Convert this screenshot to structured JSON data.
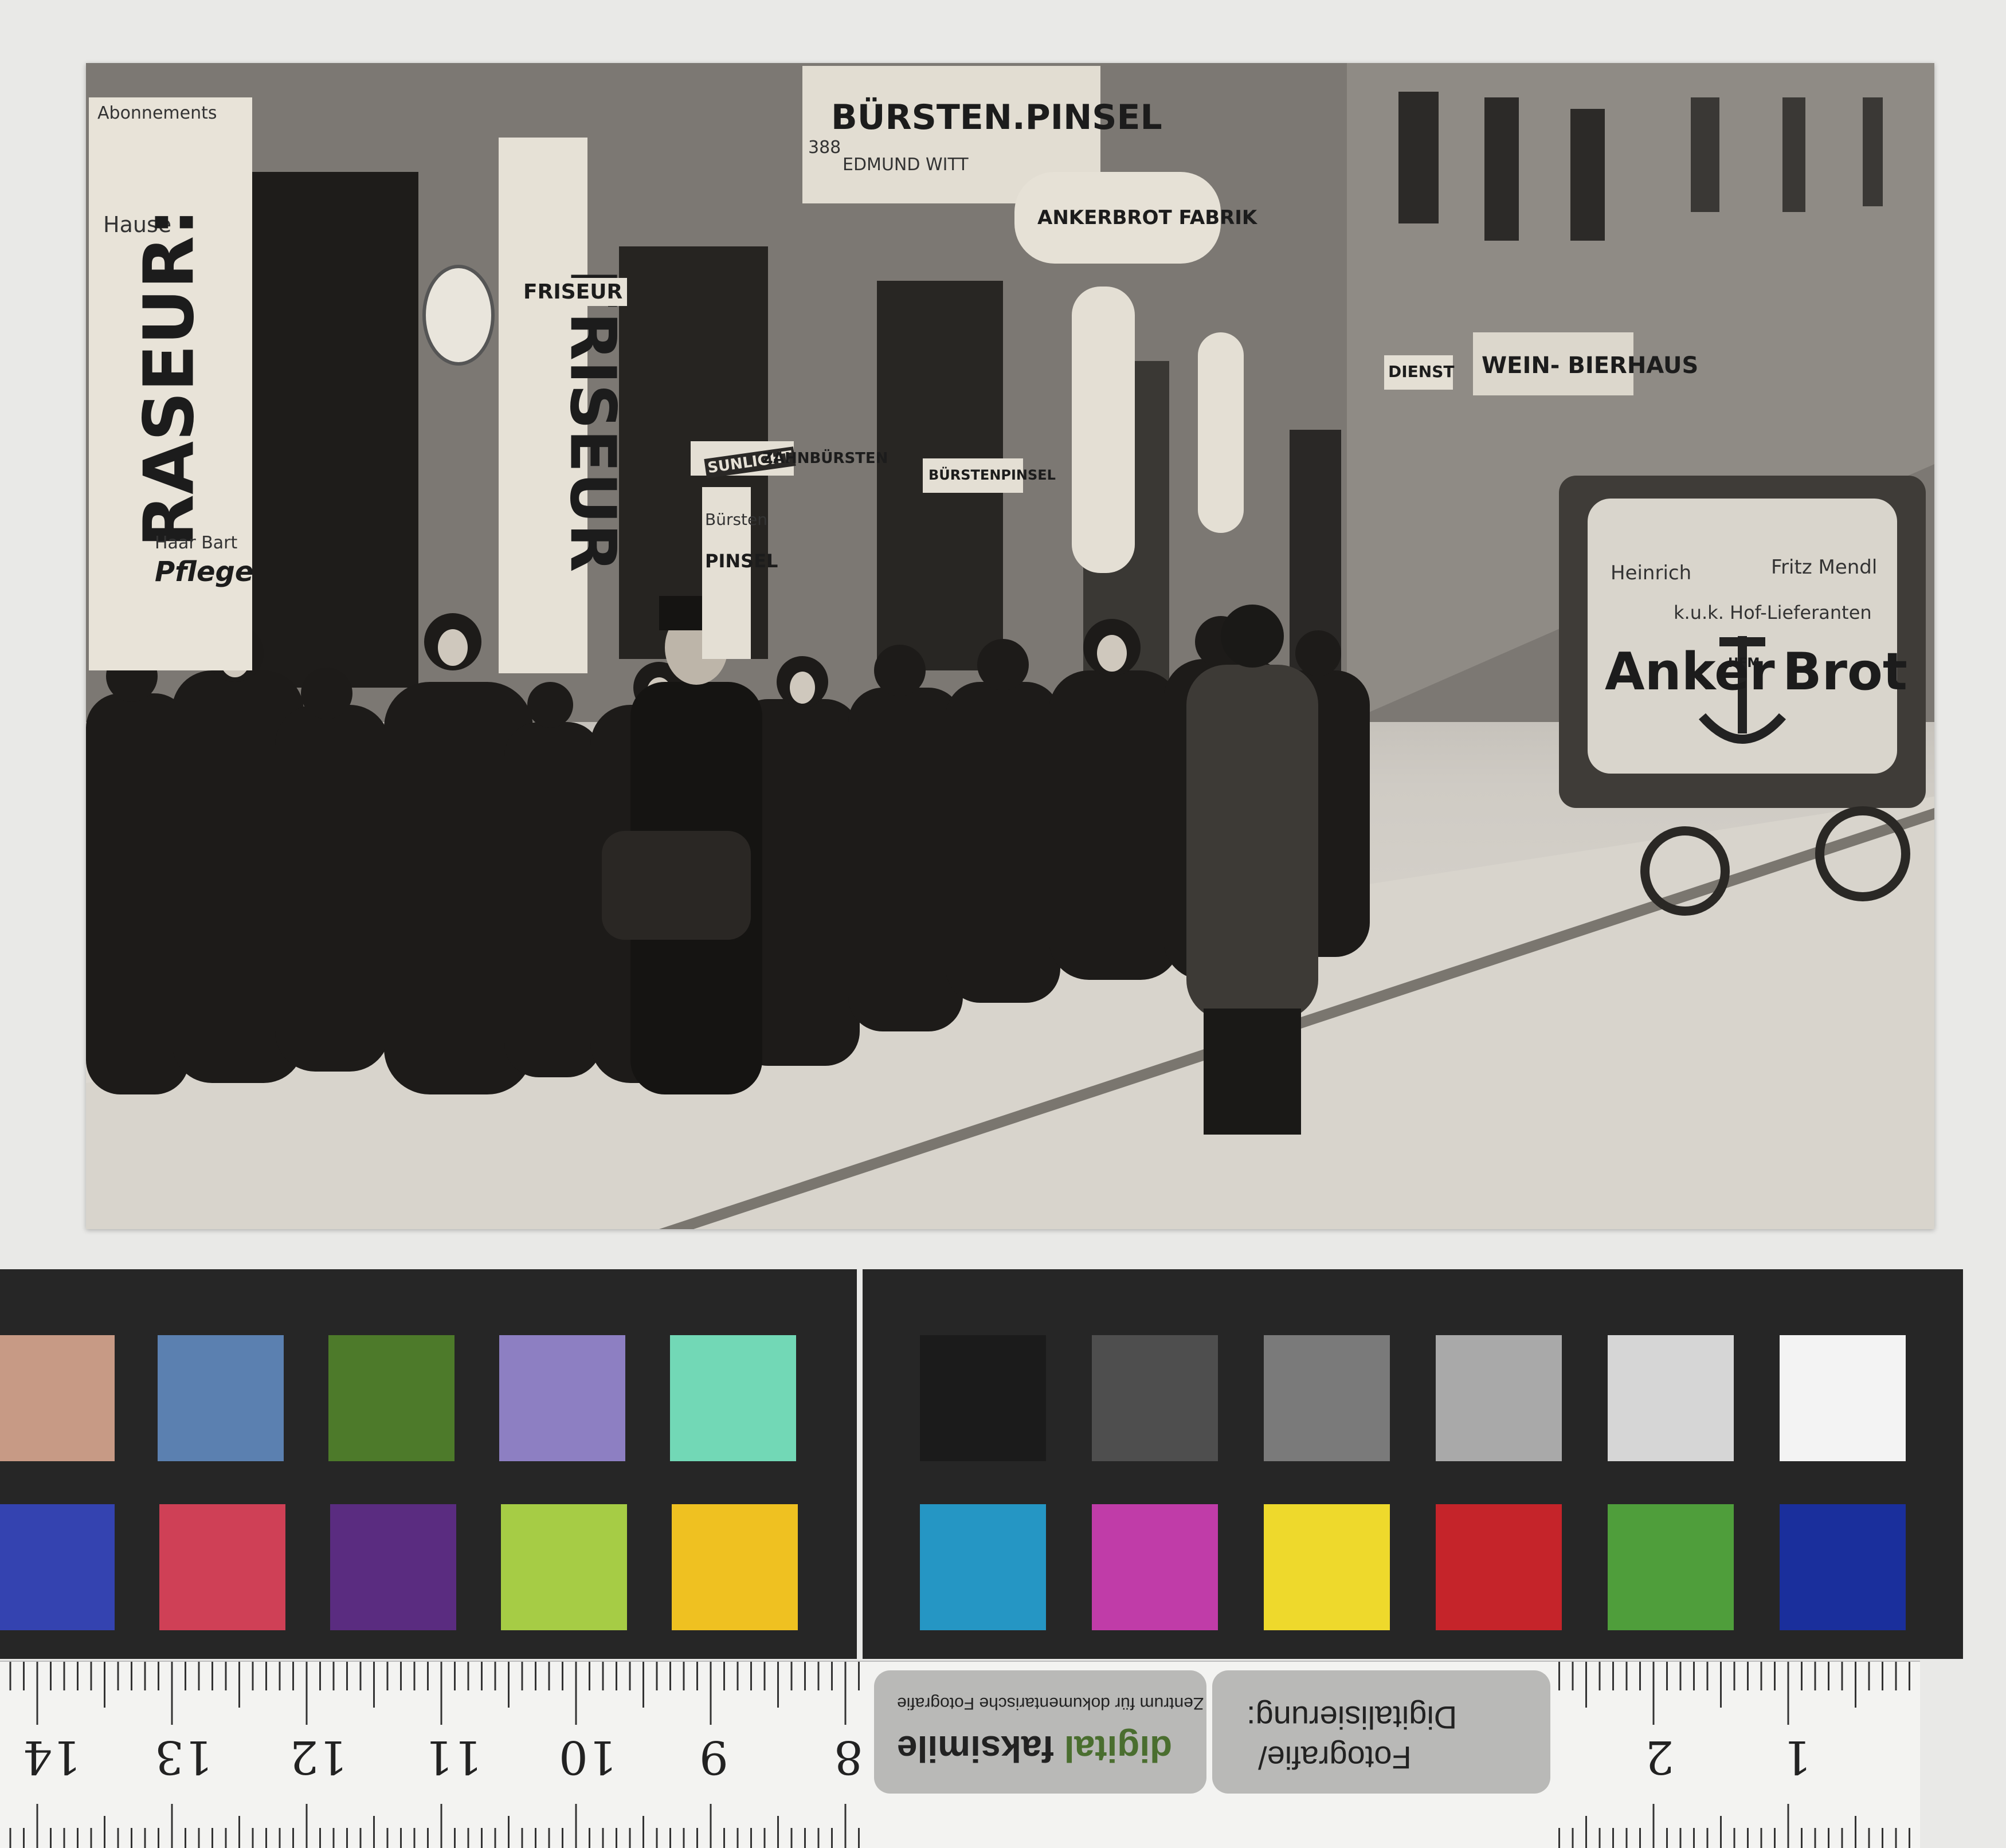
{
  "photo": {
    "signs": {
      "raseur": "RASEUR:",
      "abonnements": "Abonnements",
      "hause": "Hause",
      "haar_bart": "Haar Bart",
      "pflege": "Pflege",
      "friseur_board": "FRISEUR",
      "friseur_small": "FRISEUR",
      "buersten_pinsel": "BÜRSTEN.PINSEL",
      "edmund": "EDMUND WITT",
      "number": "388",
      "ankerbrot_fabrik": "ANKERBROT FABRIK",
      "sunlight": "SUNLIGHT",
      "zahnbuersten": "ZAHNBÜRSTEN",
      "buersten": "Bürsten",
      "pinsel": "PINSEL",
      "buerstenpinsel_small": "BÜRSTENPINSEL",
      "dienst": "DIENST",
      "wein_bierhaus": "WEIN- BIERHAUS",
      "cart_heinrich": "Heinrich",
      "cart_fritz": "Fritz Mendl",
      "cart_hoflieferanten": "k.u.k. Hof-Lieferanten",
      "cart_anker": "Anker",
      "cart_brot": "Brot",
      "cart_hfm": "HFM"
    }
  },
  "colorcard": {
    "left": {
      "top": [
        "#c79a85",
        "#5b80b0",
        "#4d7a2a",
        "#8d7fc2",
        "#72d8b6"
      ],
      "bottom": [
        "#3443b0",
        "#cf4056",
        "#5a2c80",
        "#a6cc45",
        "#efc121"
      ]
    },
    "right": {
      "top": [
        "#1b1b1b",
        "#4e4e4e",
        "#7a7a7a",
        "#a9a9a9",
        "#d6d6d6",
        "#f3f3f3"
      ],
      "bottom": [
        "#2596c4",
        "#c03ca8",
        "#eed92c",
        "#c5242a",
        "#4f9e3b",
        "#1a2f9c"
      ]
    }
  },
  "ruler": {
    "numbers": [
      "14",
      "13",
      "12",
      "11",
      "10",
      "9",
      "8",
      "2",
      "1"
    ],
    "label_left": {
      "line1": "Zentrum für dokumentarische Fotografie",
      "brand1": "faksimile",
      "brand2": "digital"
    },
    "label_right": {
      "line1": "Fotografie/",
      "line2": "Digitalisierung:"
    }
  }
}
